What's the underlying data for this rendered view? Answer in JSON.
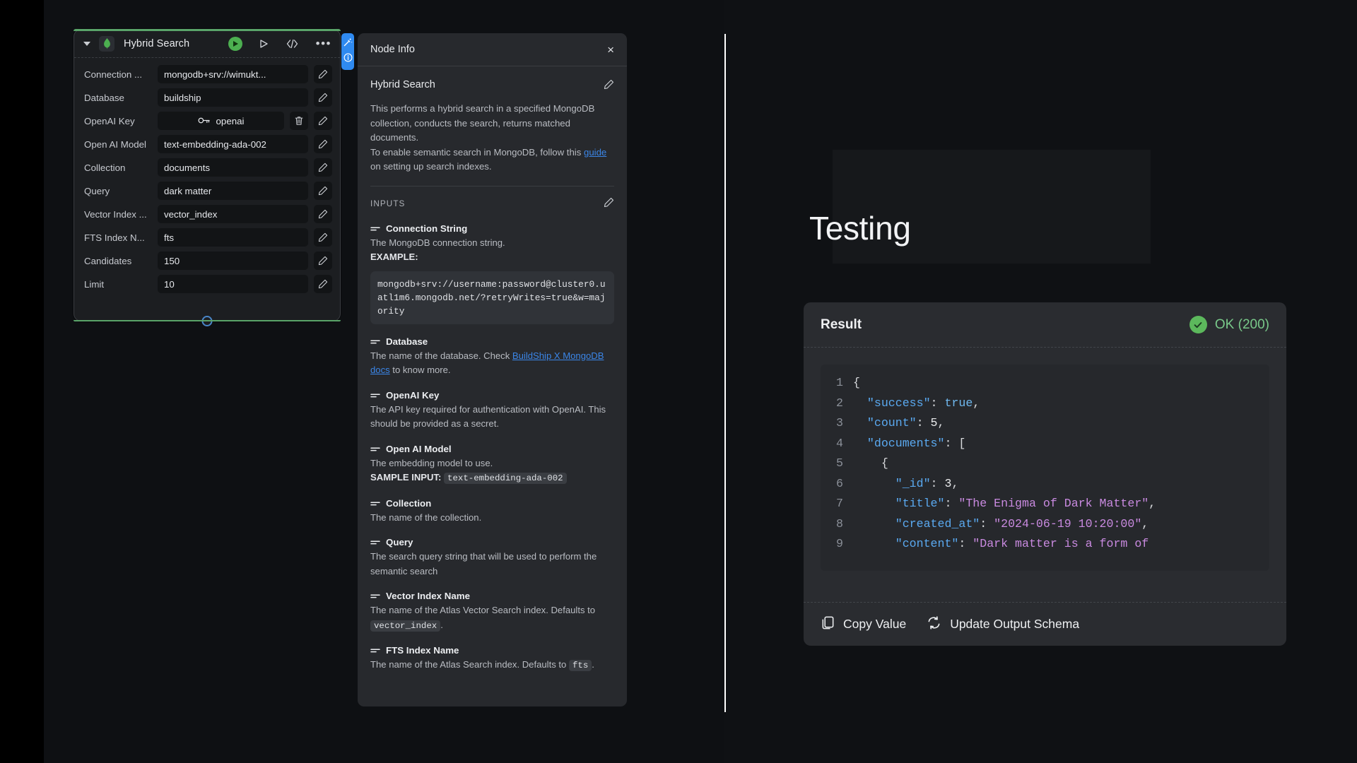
{
  "node": {
    "title": "Hybrid Search",
    "icons": {
      "collapse": "chevron-down-icon",
      "brand": "mongodb-leaf-icon",
      "run": "run-node-icon",
      "test": "play-triangle-icon",
      "code": "code-brackets-icon",
      "more": "more-options-icon"
    },
    "rows": [
      {
        "label": "Connection ...",
        "value": "mongodb+srv://wimukt...",
        "type": "text"
      },
      {
        "label": "Database",
        "value": "buildship",
        "type": "text"
      },
      {
        "label": "OpenAI Key",
        "value": "openai",
        "type": "secret"
      },
      {
        "label": "Open AI Model",
        "value": "text-embedding-ada-002",
        "type": "text"
      },
      {
        "label": "Collection",
        "value": "documents",
        "type": "text"
      },
      {
        "label": "Query",
        "value": "dark matter",
        "type": "text"
      },
      {
        "label": "Vector Index ...",
        "value": "vector_index",
        "type": "text"
      },
      {
        "label": "FTS Index N...",
        "value": "fts",
        "type": "text"
      },
      {
        "label": "Candidates",
        "value": "150",
        "type": "text"
      },
      {
        "label": "Limit",
        "value": "10",
        "type": "text"
      }
    ]
  },
  "side_tab": {
    "magic_icon": "magic-wand-icon",
    "info_icon": "info-circle-icon"
  },
  "info_panel": {
    "header_title": "Node Info",
    "close_label": "×",
    "section_title": "Hybrid Search",
    "description_lines": [
      "This performs a hybrid search in a specified MongoDB collection, conducts the search, returns matched documents.",
      "To enable semantic search in MongoDB, follow this guide on setting up search indexes."
    ],
    "desc_p1": "This performs a hybrid search in a specified MongoDB collection, conducts the search, returns matched documents.",
    "desc_p2_pre": "To enable semantic search in MongoDB, follow this ",
    "desc_p2_link": "guide",
    "desc_p2_post": " on setting up search indexes.",
    "inputs_label": "INPUTS",
    "params": [
      {
        "name": "Connection String",
        "desc": "The MongoDB connection string.",
        "example_label": "EXAMPLE:",
        "example_code": "mongodb+srv://username:password@cluster0.uatl1m6.mongodb.net/?retryWrites=true&w=majority"
      },
      {
        "name": "Database",
        "desc_pre": "The name of the database. Check ",
        "desc_link": "BuildShip X MongoDB docs",
        "desc_post": " to know more."
      },
      {
        "name": "OpenAI Key",
        "desc": "The API key required for authentication with OpenAI. This should be provided as a secret."
      },
      {
        "name": "Open AI Model",
        "desc": "The embedding model to use.",
        "sample_label": "SAMPLE INPUT:",
        "sample_code": "text-embedding-ada-002"
      },
      {
        "name": "Collection",
        "desc": "The name of the collection."
      },
      {
        "name": "Query",
        "desc": "The search query string that will be used to perform the semantic search"
      },
      {
        "name": "Vector Index Name",
        "desc_pre": "The name of the Atlas Vector Search index. Defaults to ",
        "desc_code": "vector_index",
        "desc_post": "."
      },
      {
        "name": "FTS Index Name",
        "desc_pre": "The name of the Atlas Search index. Defaults to ",
        "desc_code": "fts",
        "desc_post": "."
      }
    ]
  },
  "canvas": {
    "label": "Testing"
  },
  "result": {
    "title": "Result",
    "status_text": "OK (200)",
    "status_icon": "check-circle-icon",
    "code_lines": [
      {
        "n": "1",
        "tokens": [
          {
            "t": "{",
            "c": "pl"
          }
        ]
      },
      {
        "n": "2",
        "tokens": [
          {
            "t": "  \"success\"",
            "c": "key"
          },
          {
            "t": ": ",
            "c": "pl"
          },
          {
            "t": "true",
            "c": "bool"
          },
          {
            "t": ",",
            "c": "pl"
          }
        ]
      },
      {
        "n": "3",
        "tokens": [
          {
            "t": "  \"count\"",
            "c": "key"
          },
          {
            "t": ": ",
            "c": "pl"
          },
          {
            "t": "5",
            "c": "num"
          },
          {
            "t": ",",
            "c": "pl"
          }
        ]
      },
      {
        "n": "4",
        "tokens": [
          {
            "t": "  \"documents\"",
            "c": "key"
          },
          {
            "t": ": [",
            "c": "pl"
          }
        ]
      },
      {
        "n": "5",
        "tokens": [
          {
            "t": "    {",
            "c": "pl"
          }
        ]
      },
      {
        "n": "6",
        "tokens": [
          {
            "t": "      \"_id\"",
            "c": "key"
          },
          {
            "t": ": ",
            "c": "pl"
          },
          {
            "t": "3",
            "c": "num"
          },
          {
            "t": ",",
            "c": "pl"
          }
        ]
      },
      {
        "n": "7",
        "tokens": [
          {
            "t": "      \"title\"",
            "c": "key"
          },
          {
            "t": ": ",
            "c": "pl"
          },
          {
            "t": "\"The Enigma of Dark Matter\"",
            "c": "str"
          },
          {
            "t": ",",
            "c": "pl"
          }
        ]
      },
      {
        "n": "8",
        "tokens": [
          {
            "t": "      \"created_at\"",
            "c": "key"
          },
          {
            "t": ": ",
            "c": "pl"
          },
          {
            "t": "\"2024-06-19 10:20:00\"",
            "c": "str"
          },
          {
            "t": ",",
            "c": "pl"
          }
        ]
      },
      {
        "n": "9",
        "tokens": [
          {
            "t": "      \"content\"",
            "c": "key"
          },
          {
            "t": ": ",
            "c": "pl"
          },
          {
            "t": "\"Dark matter is a form of",
            "c": "str"
          }
        ]
      }
    ],
    "copy_label": "Copy Value",
    "update_label": "Update Output Schema",
    "copy_icon": "copy-icon",
    "update_icon": "refresh-icon"
  },
  "colors": {
    "accent_green": "#5aa469",
    "accent_blue": "#2f8af0",
    "status_green": "#79c98a",
    "link_blue": "#3b86e8"
  }
}
